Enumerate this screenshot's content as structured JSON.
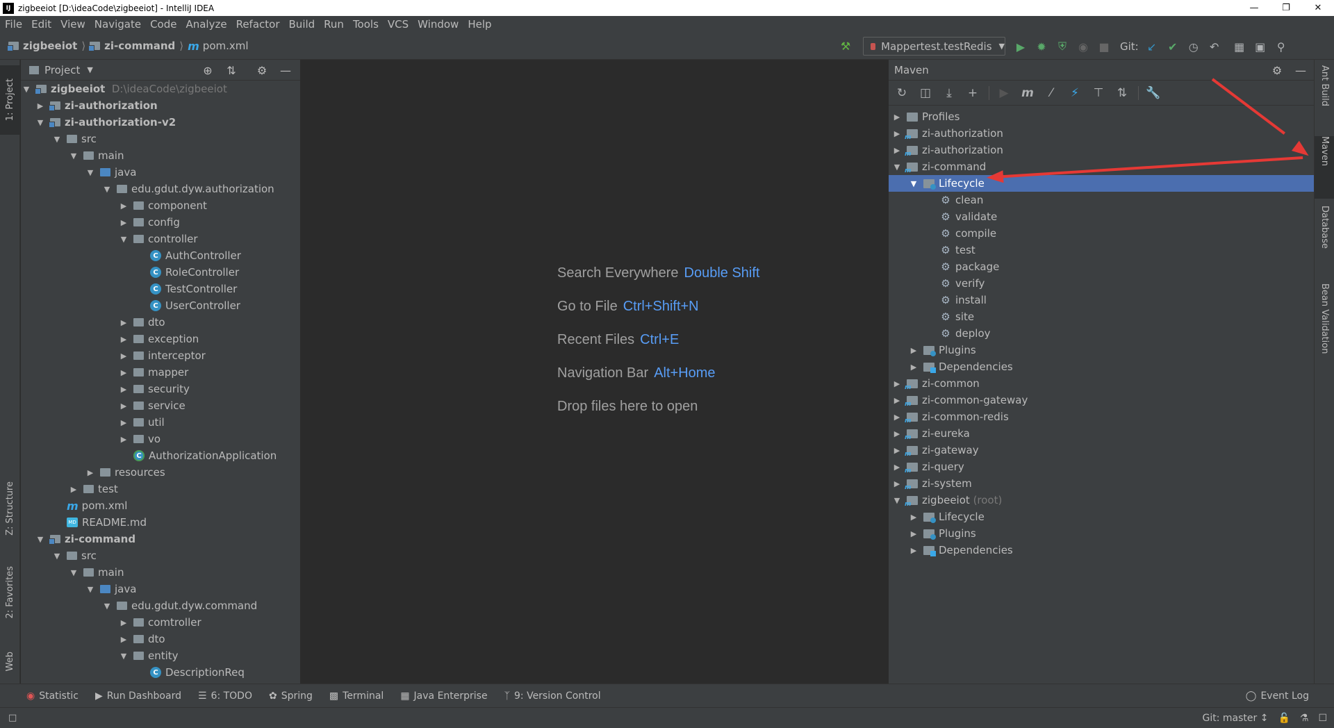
{
  "window": {
    "title": "zigbeeiot [D:\\ideaCode\\zigbeeiot] - IntelliJ IDEA",
    "app_badge": "IJ"
  },
  "menu": [
    "File",
    "Edit",
    "View",
    "Navigate",
    "Code",
    "Analyze",
    "Refactor",
    "Build",
    "Run",
    "Tools",
    "VCS",
    "Window",
    "Help"
  ],
  "breadcrumb": {
    "project": "zigbeeiot",
    "module": "zi-command",
    "file": "pom.xml"
  },
  "run_config": "Mappertest.testRedis",
  "git_label": "Git:",
  "left_tabs": {
    "project": "1: Project",
    "structure": "Z: Structure",
    "favorites": "2: Favorites",
    "web": "Web"
  },
  "right_tabs": {
    "ant": "Ant Build",
    "maven": "Maven",
    "database": "Database",
    "bean": "Bean Validation"
  },
  "project_panel": {
    "title": "Project",
    "tree": [
      {
        "label": "zigbeeiot",
        "hint": "D:\\ideaCode\\zigbeeiot"
      },
      {
        "label": "zi-authorization"
      },
      {
        "label": "zi-authorization-v2"
      },
      {
        "label": "src"
      },
      {
        "label": "main"
      },
      {
        "label": "java"
      },
      {
        "label": "edu.gdut.dyw.authorization"
      },
      {
        "label": "component"
      },
      {
        "label": "config"
      },
      {
        "label": "controller"
      },
      {
        "label": "AuthController"
      },
      {
        "label": "RoleController"
      },
      {
        "label": "TestController"
      },
      {
        "label": "UserController"
      },
      {
        "label": "dto"
      },
      {
        "label": "exception"
      },
      {
        "label": "interceptor"
      },
      {
        "label": "mapper"
      },
      {
        "label": "security"
      },
      {
        "label": "service"
      },
      {
        "label": "util"
      },
      {
        "label": "vo"
      },
      {
        "label": "AuthorizationApplication"
      },
      {
        "label": "resources"
      },
      {
        "label": "test"
      },
      {
        "label": "pom.xml"
      },
      {
        "label": "README.md"
      },
      {
        "label": "zi-command"
      },
      {
        "label": "src"
      },
      {
        "label": "main"
      },
      {
        "label": "java"
      },
      {
        "label": "edu.gdut.dyw.command"
      },
      {
        "label": "comtroller"
      },
      {
        "label": "dto"
      },
      {
        "label": "entity"
      },
      {
        "label": "DescriptionReq"
      }
    ]
  },
  "welcome": [
    {
      "text": "Search Everywhere",
      "key": "Double Shift"
    },
    {
      "text": "Go to File",
      "key": "Ctrl+Shift+N"
    },
    {
      "text": "Recent Files",
      "key": "Ctrl+E"
    },
    {
      "text": "Navigation Bar",
      "key": "Alt+Home"
    },
    {
      "text": "Drop files here to open",
      "key": ""
    }
  ],
  "maven_panel": {
    "title": "Maven",
    "tree": [
      {
        "label": "Profiles"
      },
      {
        "label": "zi-authorization"
      },
      {
        "label": "zi-authorization"
      },
      {
        "label": "zi-command"
      },
      {
        "label": "Lifecycle"
      },
      {
        "label": "clean"
      },
      {
        "label": "validate"
      },
      {
        "label": "compile"
      },
      {
        "label": "test"
      },
      {
        "label": "package"
      },
      {
        "label": "verify"
      },
      {
        "label": "install"
      },
      {
        "label": "site"
      },
      {
        "label": "deploy"
      },
      {
        "label": "Plugins"
      },
      {
        "label": "Dependencies"
      },
      {
        "label": "zi-common"
      },
      {
        "label": "zi-common-gateway"
      },
      {
        "label": "zi-common-redis"
      },
      {
        "label": "zi-eureka"
      },
      {
        "label": "zi-gateway"
      },
      {
        "label": "zi-query"
      },
      {
        "label": "zi-system"
      },
      {
        "label": "zigbeeiot",
        "hint": "(root)"
      },
      {
        "label": "Lifecycle"
      },
      {
        "label": "Plugins"
      },
      {
        "label": "Dependencies"
      }
    ]
  },
  "bottom_tabs": [
    "Statistic",
    "Run Dashboard",
    "6: TODO",
    "Spring",
    "Terminal",
    "Java Enterprise",
    "9: Version Control"
  ],
  "event_log": "Event Log",
  "status": {
    "git_branch": "Git: master ↕"
  },
  "colors": {
    "accent": "#4b6eaf",
    "link": "#589df6",
    "annotation": "#e53935"
  }
}
